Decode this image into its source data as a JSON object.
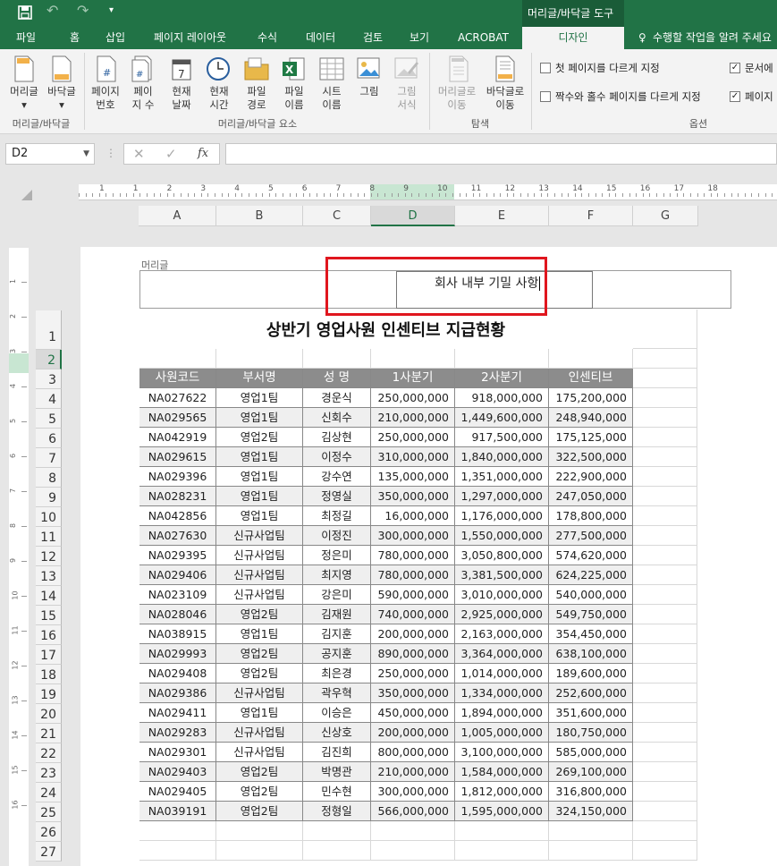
{
  "window": {
    "context_tab": "머리글/바닥글 도구"
  },
  "tabs": [
    "파일",
    "홈",
    "삽입",
    "페이지 레이아웃",
    "수식",
    "데이터",
    "검토",
    "보기",
    "ACROBAT",
    "디자인"
  ],
  "tell_me": "수행할 작업을 알려 주세요",
  "ribbon": {
    "group1": {
      "buttons": [
        "머리글",
        "바닥글"
      ],
      "label": "머리글/바닥글"
    },
    "group2": {
      "buttons": [
        "페이지\n번호",
        "페이\n지 수",
        "현재\n날짜",
        "현재\n시간",
        "파일\n경로",
        "파일\n이름",
        "시트\n이름",
        "그림",
        "그림\n서식"
      ],
      "label": "머리글/바닥글 요소"
    },
    "group3": {
      "buttons": [
        "머리글로\n이동",
        "바닥글로\n이동"
      ],
      "label": "탐색"
    },
    "group4": {
      "label": "옵션",
      "options": [
        {
          "label": "첫 페이지를 다르게 지정",
          "checked": false
        },
        {
          "label": "짝수와 홀수 페이지를 다르게 지정",
          "checked": false
        },
        {
          "label": "문서에",
          "checked": true
        },
        {
          "label": "페이지",
          "checked": true
        }
      ]
    }
  },
  "formula_bar": {
    "name_box": "D2",
    "fx": "fx",
    "value": ""
  },
  "ruler": {
    "numbers": [
      "1",
      "1",
      "2",
      "3",
      "4",
      "5",
      "6",
      "7",
      "8",
      "9",
      "10",
      "11",
      "12",
      "13",
      "14",
      "15",
      "16",
      "17",
      "18"
    ]
  },
  "columns": [
    "A",
    "B",
    "C",
    "D",
    "E",
    "F",
    "G"
  ],
  "selected_column": "D",
  "rows": [
    "1",
    "2",
    "3",
    "4",
    "5",
    "6",
    "7",
    "8",
    "9",
    "10",
    "11",
    "12",
    "13",
    "14",
    "15",
    "16",
    "17",
    "18",
    "19",
    "20",
    "21",
    "22",
    "23",
    "24",
    "25",
    "26",
    "27"
  ],
  "selected_row": "2",
  "header_area": {
    "label": "머리글",
    "text": "회사 내부 기밀 사항"
  },
  "sheet": {
    "title": "상반기 영업사원 인센티브 지급현황",
    "headers": [
      "사원코드",
      "부서명",
      "성  명",
      "1사분기",
      "2사분기",
      "인센티브"
    ],
    "data": [
      [
        "NA027622",
        "영업1팀",
        "경운식",
        "250,000,000",
        "918,000,000",
        "175,200,000"
      ],
      [
        "NA029565",
        "영업1팀",
        "신회수",
        "210,000,000",
        "1,449,600,000",
        "248,940,000"
      ],
      [
        "NA042919",
        "영업2팀",
        "김상현",
        "250,000,000",
        "917,500,000",
        "175,125,000"
      ],
      [
        "NA029615",
        "영업1팀",
        "이정수",
        "310,000,000",
        "1,840,000,000",
        "322,500,000"
      ],
      [
        "NA029396",
        "영업1팀",
        "강수연",
        "135,000,000",
        "1,351,000,000",
        "222,900,000"
      ],
      [
        "NA028231",
        "영업1팀",
        "정영실",
        "350,000,000",
        "1,297,000,000",
        "247,050,000"
      ],
      [
        "NA042856",
        "영업1팀",
        "최정길",
        "16,000,000",
        "1,176,000,000",
        "178,800,000"
      ],
      [
        "NA027630",
        "신규사업팀",
        "이정진",
        "300,000,000",
        "1,550,000,000",
        "277,500,000"
      ],
      [
        "NA029395",
        "신규사업팀",
        "정은미",
        "780,000,000",
        "3,050,800,000",
        "574,620,000"
      ],
      [
        "NA029406",
        "신규사업팀",
        "최지영",
        "780,000,000",
        "3,381,500,000",
        "624,225,000"
      ],
      [
        "NA023109",
        "신규사업팀",
        "강은미",
        "590,000,000",
        "3,010,000,000",
        "540,000,000"
      ],
      [
        "NA028046",
        "영업2팀",
        "김재원",
        "740,000,000",
        "2,925,000,000",
        "549,750,000"
      ],
      [
        "NA038915",
        "영업1팀",
        "김지훈",
        "200,000,000",
        "2,163,000,000",
        "354,450,000"
      ],
      [
        "NA029993",
        "영업2팀",
        "공지훈",
        "890,000,000",
        "3,364,000,000",
        "638,100,000"
      ],
      [
        "NA029408",
        "영업2팀",
        "최은경",
        "250,000,000",
        "1,014,000,000",
        "189,600,000"
      ],
      [
        "NA029386",
        "신규사업팀",
        "곽우혁",
        "350,000,000",
        "1,334,000,000",
        "252,600,000"
      ],
      [
        "NA029411",
        "영업1팀",
        "이승은",
        "450,000,000",
        "1,894,000,000",
        "351,600,000"
      ],
      [
        "NA029283",
        "신규사업팀",
        "신상호",
        "200,000,000",
        "1,005,000,000",
        "180,750,000"
      ],
      [
        "NA029301",
        "신규사업팀",
        "김진희",
        "800,000,000",
        "3,100,000,000",
        "585,000,000"
      ],
      [
        "NA029403",
        "영업2팀",
        "박명관",
        "210,000,000",
        "1,584,000,000",
        "269,100,000"
      ],
      [
        "NA029405",
        "영업2팀",
        "민수현",
        "300,000,000",
        "1,812,000,000",
        "316,800,000"
      ],
      [
        "NA039191",
        "영업2팀",
        "정형일",
        "566,000,000",
        "1,595,000,000",
        "324,150,000"
      ]
    ]
  },
  "colors": {
    "excel_green": "#217346",
    "header_fill": "#8c8c8c",
    "highlight": "#e0161e"
  }
}
